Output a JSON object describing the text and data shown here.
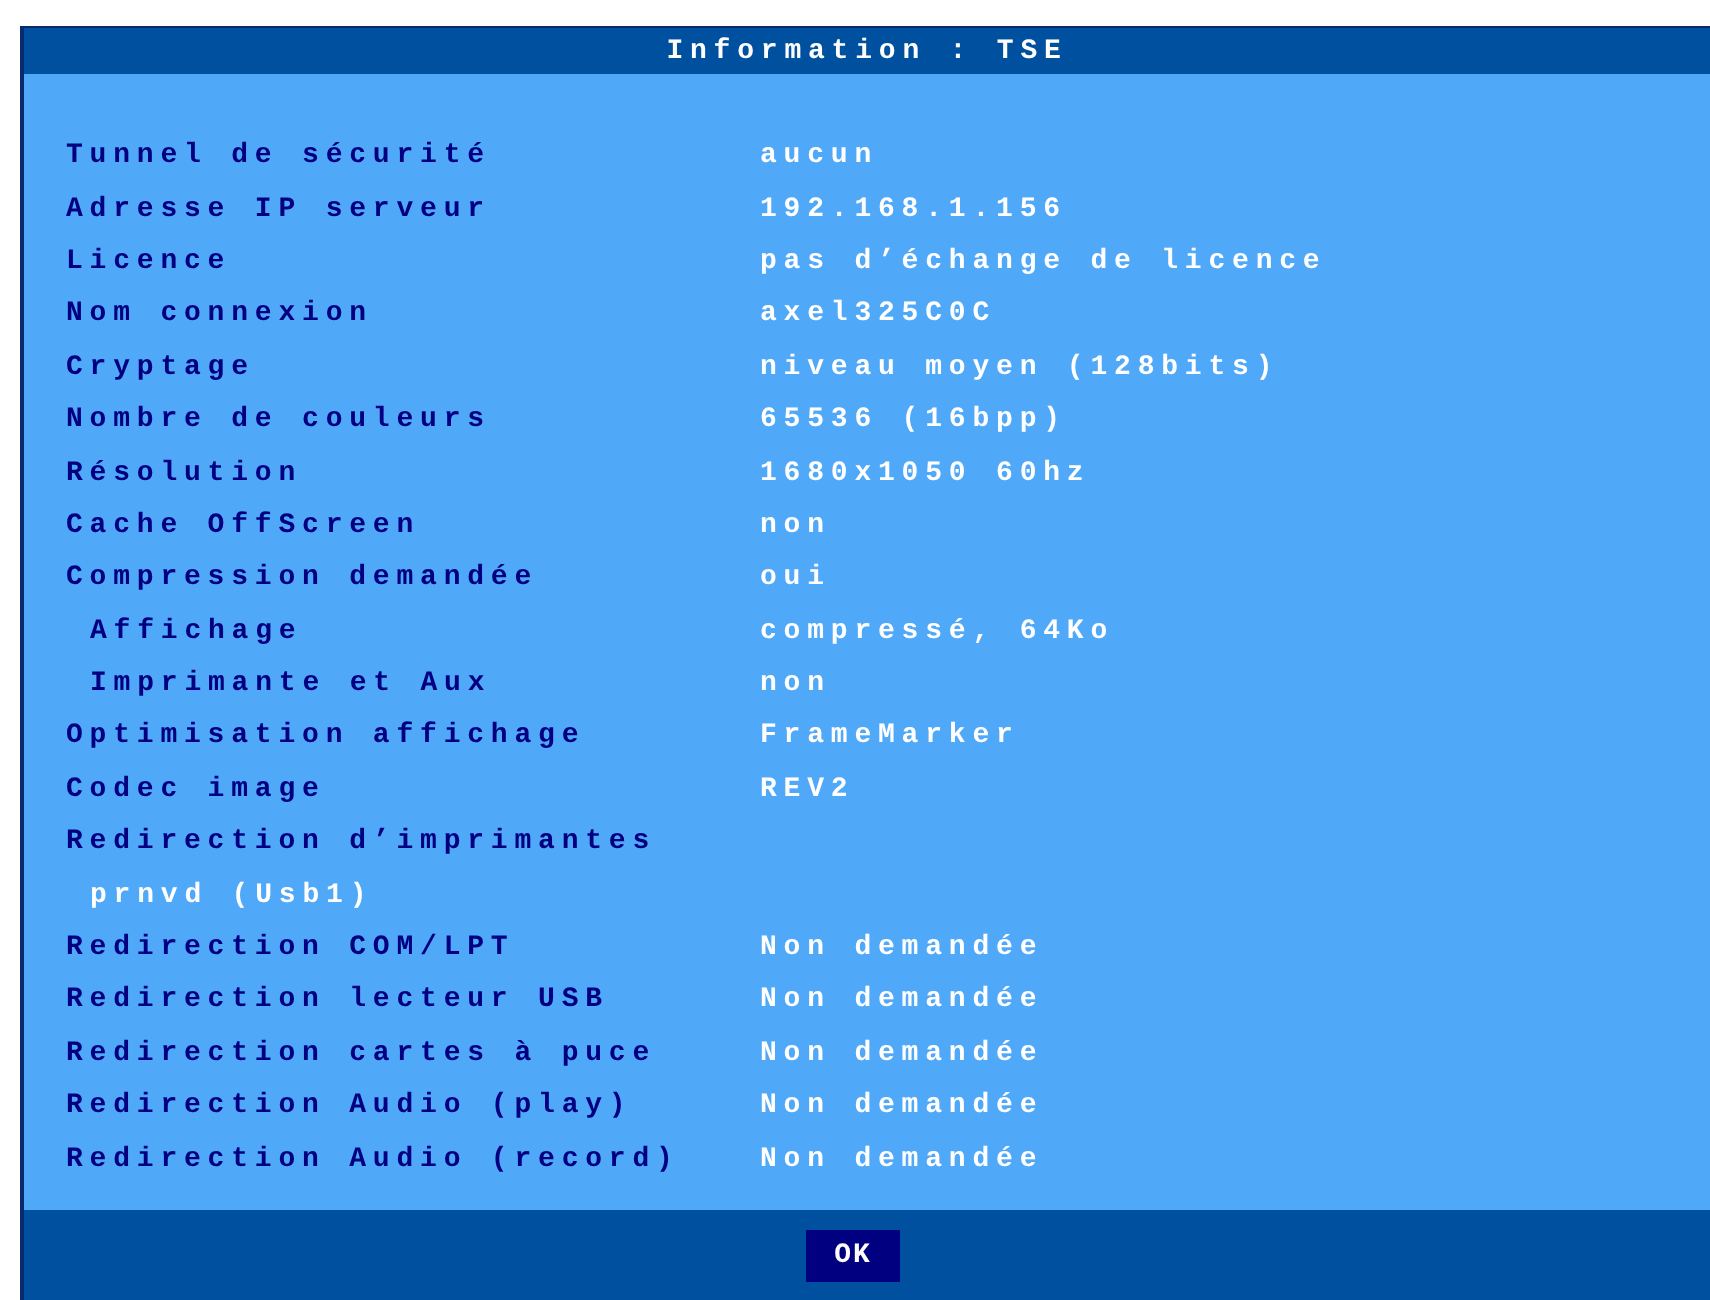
{
  "window": {
    "title": "Information : TSE"
  },
  "rows": [
    {
      "kind": "item",
      "label": "Tunnel de sécurité",
      "value": "aucun"
    },
    {
      "kind": "item",
      "label": "Adresse IP serveur",
      "value": "192.168.1.156"
    },
    {
      "kind": "item",
      "label": "Licence",
      "value": "pas d’échange de licence"
    },
    {
      "kind": "item",
      "label": "Nom connexion",
      "value": "axel325C0C"
    },
    {
      "kind": "item",
      "label": "Cryptage",
      "value": "niveau moyen (128bits)"
    },
    {
      "kind": "item",
      "label": "Nombre de couleurs",
      "value": "65536 (16bpp)"
    },
    {
      "kind": "item",
      "label": "Résolution",
      "value": "1680x1050 60hz"
    },
    {
      "kind": "item",
      "label": "Cache OffScreen",
      "value": "non"
    },
    {
      "kind": "item",
      "label": "Compression demandée",
      "value": "oui"
    },
    {
      "kind": "subitem",
      "label": "Affichage",
      "value": "compressé, 64Ko"
    },
    {
      "kind": "subitem",
      "label": "Imprimante et Aux",
      "value": "non"
    },
    {
      "kind": "item",
      "label": "Optimisation affichage",
      "value": "FrameMarker"
    },
    {
      "kind": "item",
      "label": "Codec image",
      "value": "REV2"
    },
    {
      "kind": "item",
      "label": "Redirection d’imprimantes"
    },
    {
      "kind": "note",
      "value": "prnvd (Usb1)"
    },
    {
      "kind": "item",
      "label": "Redirection COM/LPT",
      "value": "Non demandée"
    },
    {
      "kind": "item",
      "label": "Redirection lecteur USB",
      "value": "Non demandée"
    },
    {
      "kind": "item",
      "label": "Redirection cartes à puce",
      "value": "Non demandée"
    },
    {
      "kind": "item",
      "label": "Redirection Audio (play)",
      "value": "Non demandée"
    },
    {
      "kind": "item",
      "label": "Redirection Audio (record)",
      "value": "Non demandée"
    }
  ],
  "buttons": [
    {
      "label": "OK"
    }
  ]
}
